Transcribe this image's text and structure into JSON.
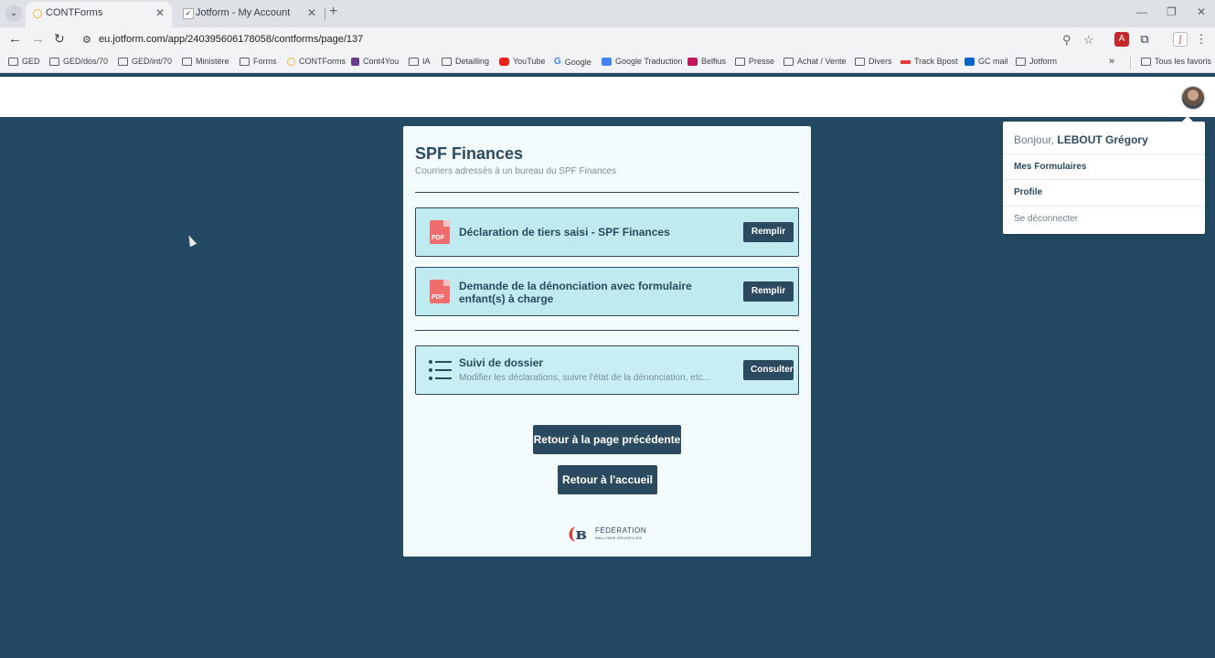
{
  "browser": {
    "tabs": [
      {
        "title": "CONTForms",
        "active": true
      },
      {
        "title": "Jotform - My Account",
        "active": false
      }
    ],
    "url": "eu.jotform.com/app/240395606178058/contforms/page/137",
    "bookmarks": [
      "GED",
      "GED/dos/70",
      "GED/int/70",
      "Ministère",
      "Forms",
      "CONTForms",
      "Cont4You",
      "IA",
      "Detailling",
      "YouTube",
      "Google",
      "Google Traduction",
      "Belfius",
      "Presse",
      "Achat / Vente",
      "Divers",
      "Track Bpost",
      "GC mail",
      "Jotform"
    ],
    "bookmarks_all": "Tous les favoris",
    "more": "»"
  },
  "card": {
    "title": "SPF Finances",
    "subtitle": "Courriers adressés à un bureau du SPF Finances",
    "items": [
      {
        "title": "Déclaration de tiers saisi - SPF Finances",
        "button": "Remplir",
        "icon": "pdf-icon"
      },
      {
        "title": "Demande de la dénonciation avec formulaire enfant(s) à charge",
        "button": "Remplir",
        "icon": "pdf-icon"
      },
      {
        "title": "Suivi de dossier",
        "description": "Modifier les déclarations, suivre l'état de la dénonciation, etc...",
        "button": "Consulter",
        "icon": "list-icon"
      }
    ],
    "back_button": "Retour à la page précédente",
    "home_button": "Retour à l'accueil",
    "logo": {
      "name": "FÉDÉRATION",
      "sub": "WALLONIE-BRUXELLES",
      "pdf_label": "PDF"
    }
  },
  "user_menu": {
    "greeting": "Bonjour,",
    "user_name": "LEBOUT Grégory",
    "items": [
      "Mes Formulaires",
      "Profile",
      "Se déconnecter"
    ]
  },
  "colors": {
    "background": "#244a63",
    "primary": "#2b4a60",
    "card": "#f3fbfc",
    "item_bg": "#bfeaf0"
  }
}
